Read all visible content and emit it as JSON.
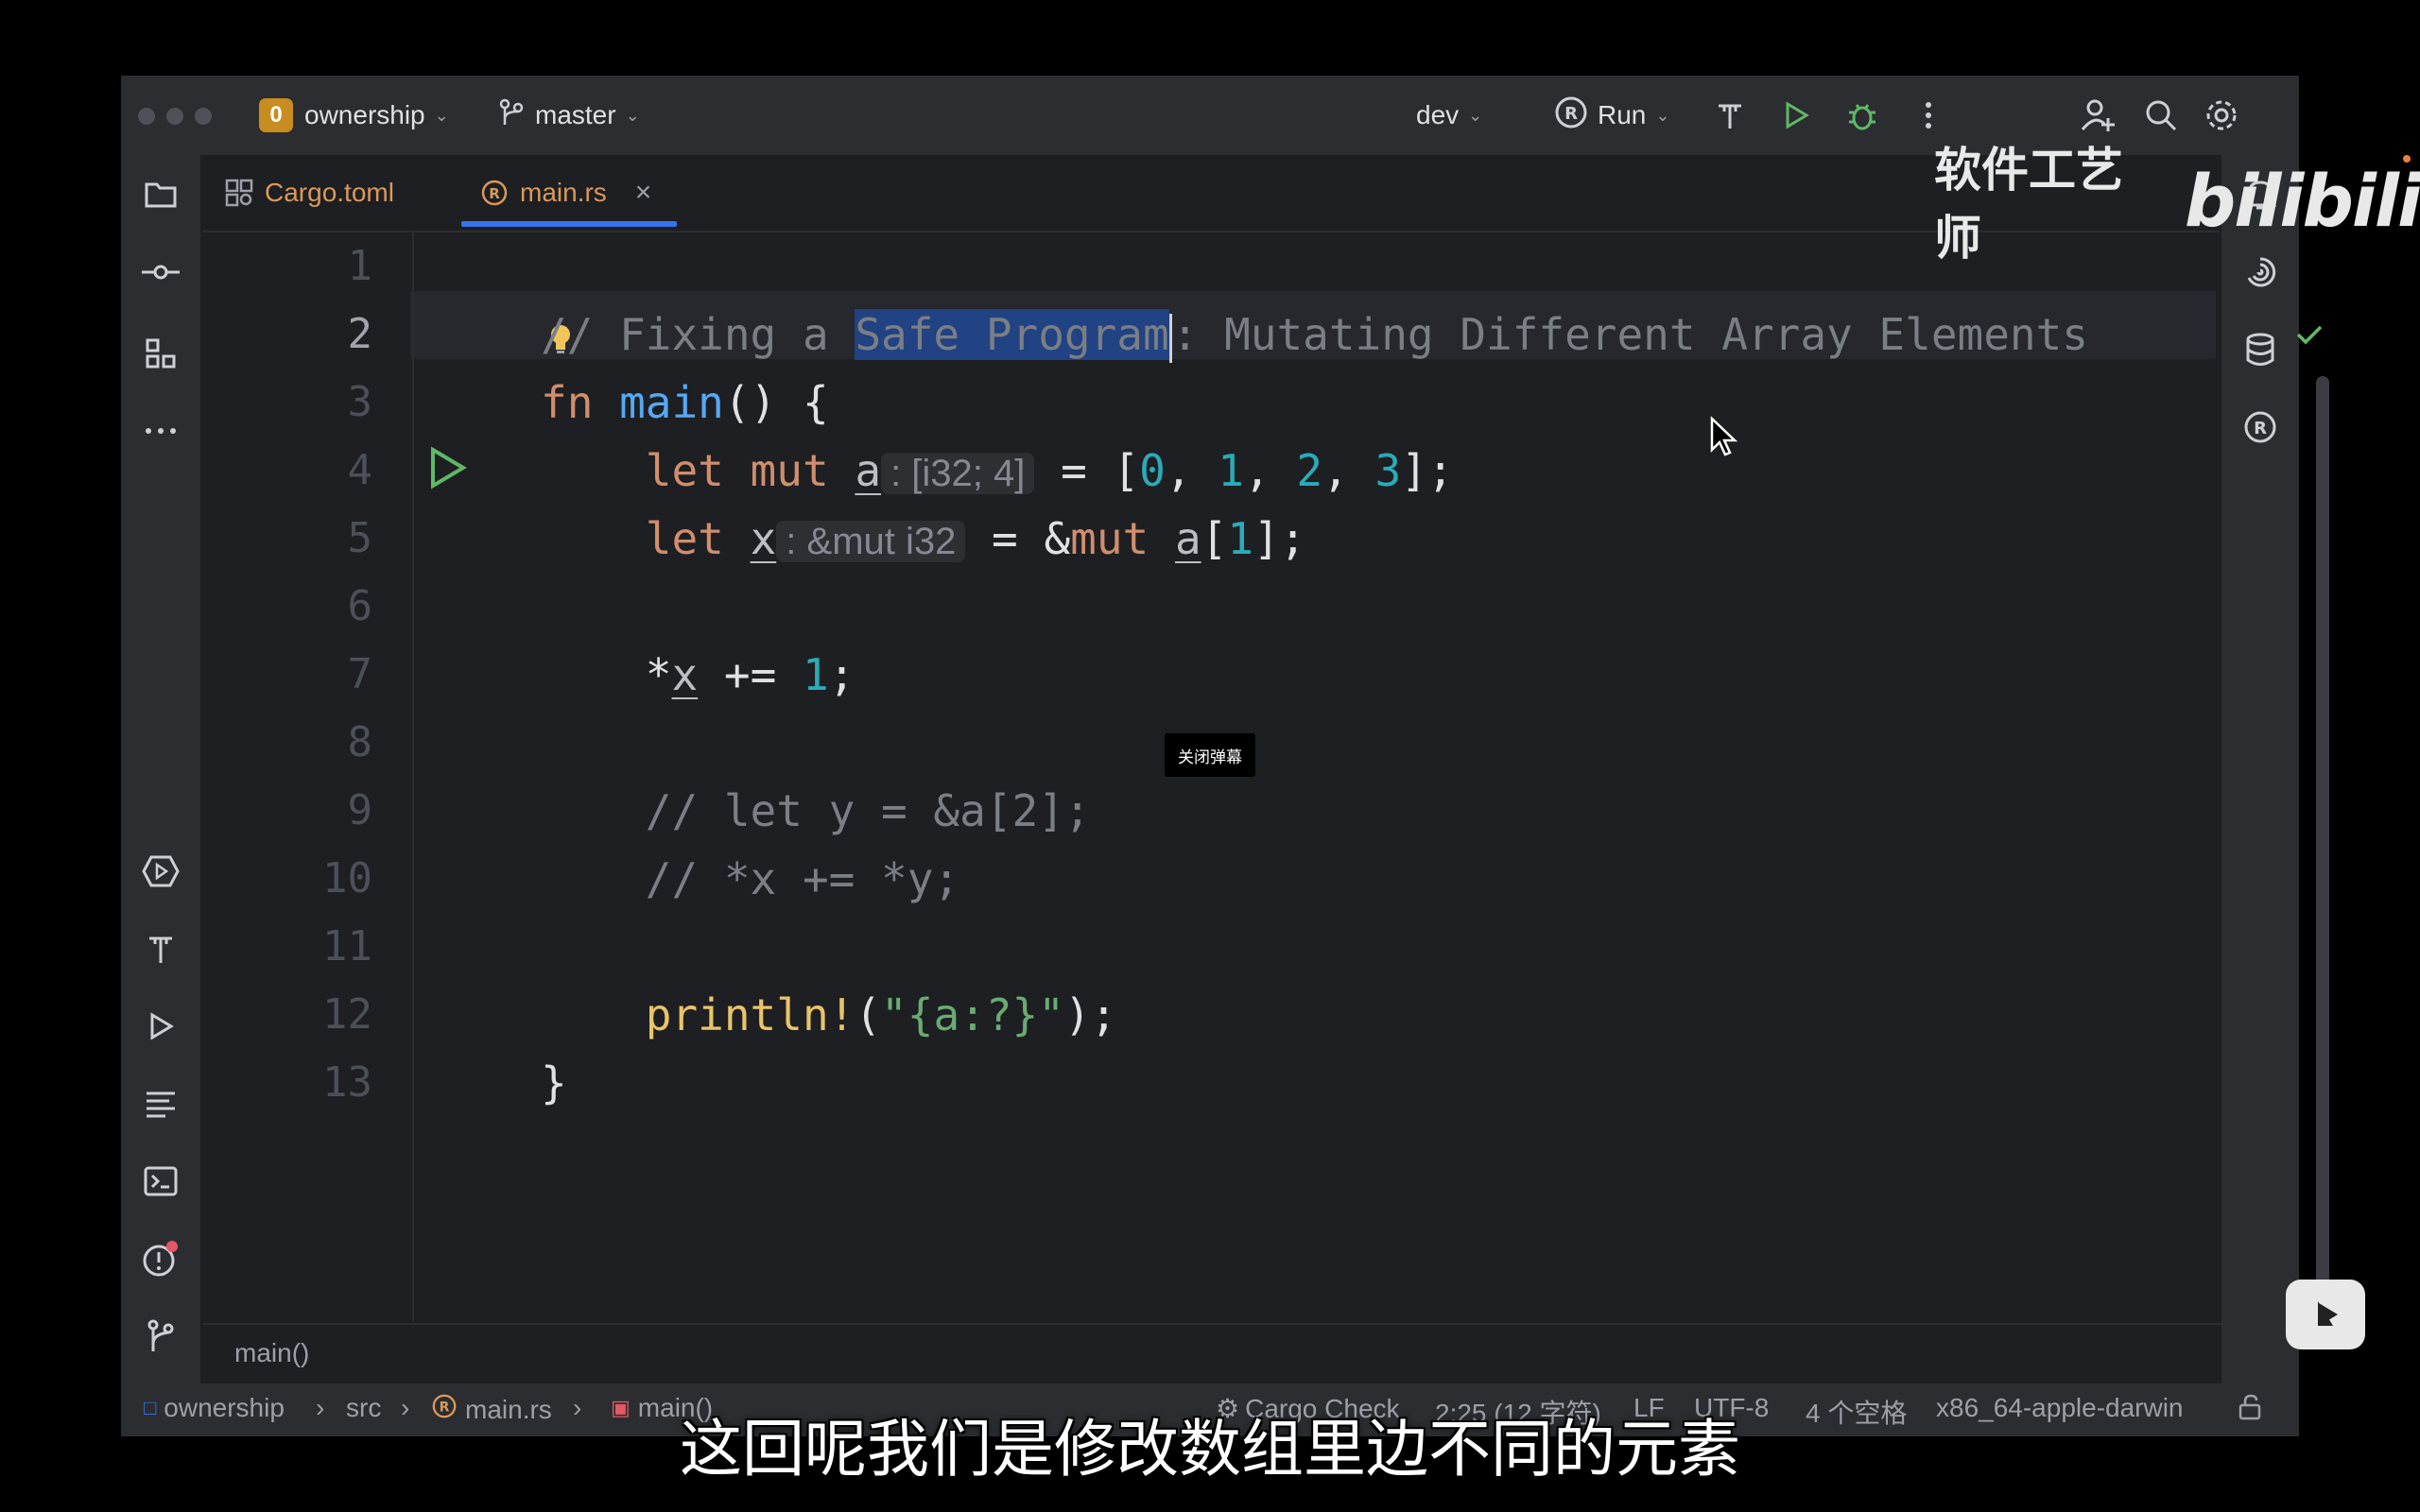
{
  "titlebar": {
    "project_badge": "0",
    "project": "ownership",
    "branch": "master",
    "run_config": "dev",
    "run_label": "Run"
  },
  "tabs": [
    {
      "label": "Cargo.toml"
    },
    {
      "label": "main.rs",
      "close": "×"
    }
  ],
  "editor": {
    "line_numbers": [
      "1",
      "2",
      "3",
      "4",
      "5",
      "6",
      "7",
      "8",
      "9",
      "10",
      "11",
      "12",
      "13"
    ],
    "current_line": 2,
    "lines": {
      "l2_pre": "// Fixing a ",
      "l2_sel": "Safe Program",
      "l2_post": ": Mutating Different Array Elements",
      "l3_kw": "fn",
      "l3_fn": "main",
      "l3_rest": "() {",
      "l4_kw": "let mut",
      "l4_var": "a",
      "l4_hint": ": [i32; 4]",
      "l4_eq": " = [",
      "l4_n0": "0",
      "l4_n1": "1",
      "l4_n2": "2",
      "l4_n3": "3",
      "l4_end": "];",
      "l5_kw": "let",
      "l5_var": "x",
      "l5_hint": ": &mut i32",
      "l5_eq": " = &",
      "l5_mut": "mut",
      "l5_a": "a",
      "l5_idx": "1",
      "l5_end": "];",
      "l7_star": "*",
      "l7_var": "x",
      "l7_op": " += ",
      "l7_num": "1",
      "l7_end": ";",
      "l9": "// let y = &a[2];",
      "l10": "// *x += *y;",
      "l12_mac": "println!",
      "l12_open": "(",
      "l12_str1": "\"",
      "l12_fmt": "{a:?}",
      "l12_str2": "\"",
      "l12_close": ");",
      "l13": "}"
    }
  },
  "breadcrumb_function": "main()",
  "status": {
    "project": "ownership",
    "src": "src",
    "file": "main.rs",
    "fn": "main()",
    "task": "Cargo Check",
    "position": "2:25 (12 字符)",
    "line_ending": "LF",
    "encoding": "UTF-8",
    "indent": "4 个空格",
    "target": "x86_64-apple-darwin"
  },
  "overlay": {
    "danmu_button": "关闭弹幕",
    "subtitle": "这回呢我们是修改数组里边不同的元素",
    "watermark_text": "软件工艺师",
    "watermark_logo": "bilibili"
  },
  "colors": {
    "accent": "#3574f0",
    "selection": "#214283",
    "keyword": "#cf8e6d",
    "function": "#56a8f5",
    "number": "#2aacb8",
    "comment": "#7a7e85"
  }
}
